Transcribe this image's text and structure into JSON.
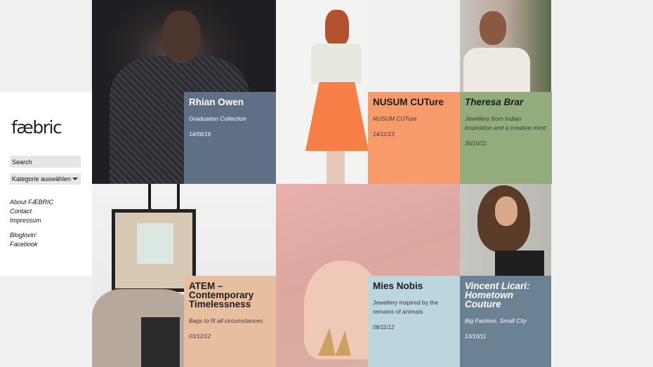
{
  "site": {
    "logo": "fæbric"
  },
  "search": {
    "placeholder": "Search"
  },
  "category": {
    "selected": "Kategorie auswählen"
  },
  "nav": {
    "links": [
      "About FÆBRIC",
      "Contact",
      "Impressum"
    ],
    "social": [
      "Bloglovin'",
      "Facebook"
    ]
  },
  "posts": [
    {
      "title": "Rhian Owen",
      "subtitle": "Graduation Collection",
      "date": "14/06/16",
      "color": "#5f6f86"
    },
    {
      "title": "NUSUM CUTure",
      "subtitle": "NUSUM CUTure",
      "date": "14/11/13",
      "color": "#f79b6a"
    },
    {
      "title": "Theresa Brar",
      "subtitle": "Jewellery from Indian inspiration and a creative mind",
      "date": "30/10/11",
      "color": "#92ac7c"
    },
    {
      "title": "ATEM – Contemporary Timelessness",
      "subtitle": "Bags to fit all circumstances",
      "date": "03/12/12",
      "color": "#e8bf9e"
    },
    {
      "title": "Mies Nobis",
      "subtitle": "Jewellery inspired by the remains of animals",
      "date": "08/11/12",
      "color": "#bcd6de"
    },
    {
      "title": "Vincent Licari: Hometown Couture",
      "subtitle": "Big Fashion, Small City",
      "date": "13/10/11",
      "color": "#6a8293"
    }
  ]
}
